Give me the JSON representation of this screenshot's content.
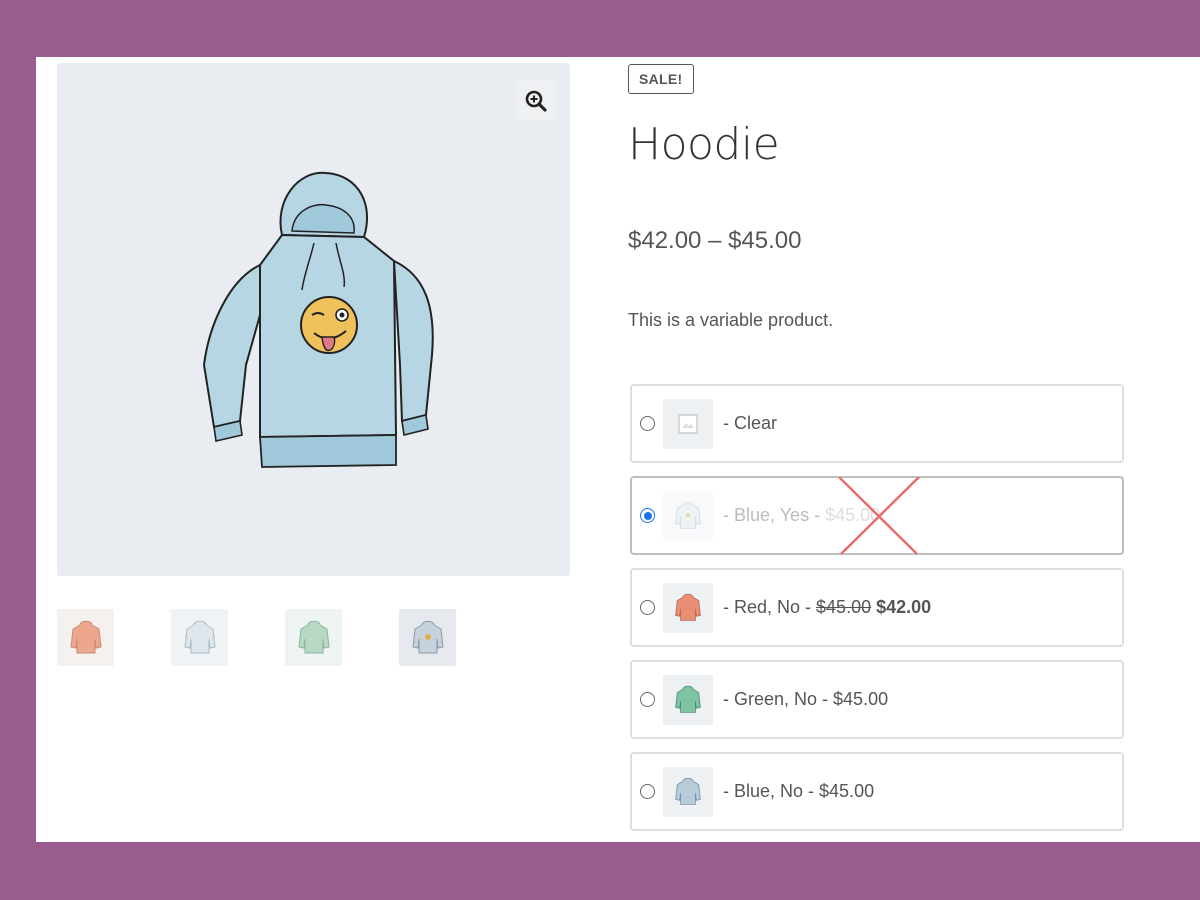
{
  "product": {
    "badge": "SALE!",
    "title": "Hoodie",
    "price_range": "$42.00 – $45.00",
    "description": "This is a variable product."
  },
  "gallery": {
    "zoom_icon": "zoom-in-icon",
    "main_image": "hoodie-light-blue-emoji",
    "thumbnails": [
      {
        "name": "thumb-red-hoodie",
        "color": "#eea78f"
      },
      {
        "name": "thumb-blue-hoodie",
        "color": "#d3dde3"
      },
      {
        "name": "thumb-green-hoodie",
        "color": "#b7d8c5"
      },
      {
        "name": "thumb-blue-logo-hoodie",
        "color": "#b9c6d0"
      }
    ]
  },
  "variations": [
    {
      "label": "- Clear",
      "selected": false
    },
    {
      "label": "- Blue, Yes - ",
      "price": "$45.00",
      "selected": true,
      "unavailable": true
    },
    {
      "label": "- Red, No - ",
      "old_price": "$45.00",
      "new_price": "$42.00",
      "selected": false
    },
    {
      "label": "- Green, No - $45.00",
      "selected": false
    },
    {
      "label": "- Blue, No - $45.00",
      "selected": false
    }
  ],
  "colors": {
    "frame": "#9a5c8e",
    "image_bg": "#e9edf1",
    "hoodie_blue": "#b7d6e4",
    "radio_selected": "#1a73e8",
    "unavailable_cross": "#e86a6a"
  }
}
